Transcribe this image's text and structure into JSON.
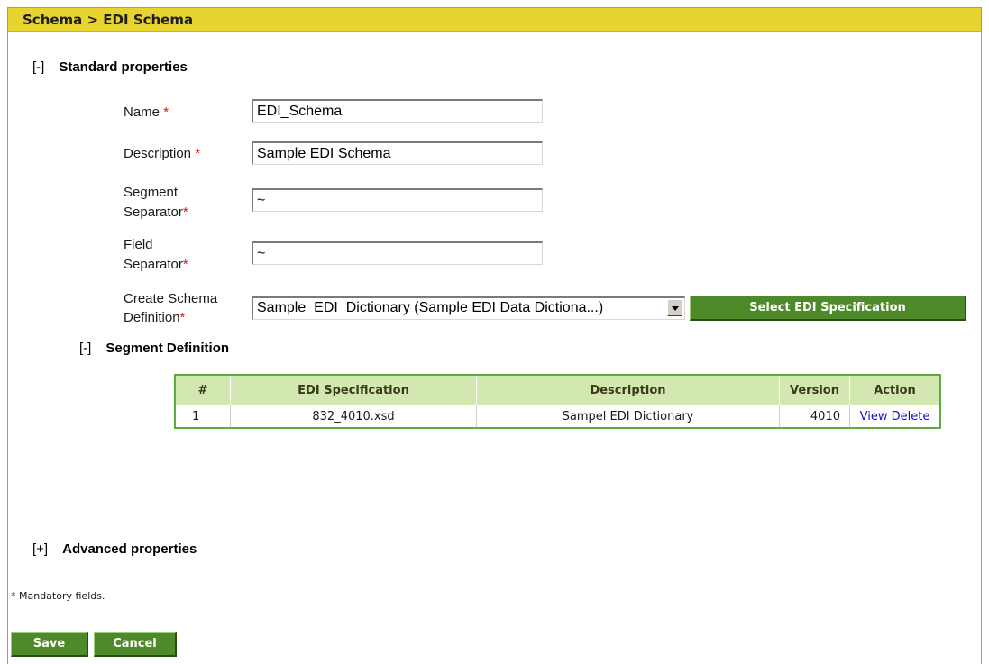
{
  "breadcrumb": "Schema > EDI Schema",
  "standard_properties": {
    "toggle": "[-]",
    "title": "Standard properties"
  },
  "fields": {
    "name": {
      "label": "Name",
      "value": "EDI_Schema"
    },
    "description": {
      "label": "Description",
      "value": "Sample EDI Schema"
    },
    "segment_separator": {
      "label_line1": "Segment",
      "label_line2": "Separator",
      "value": "~"
    },
    "field_separator": {
      "label_line1": "Field",
      "label_line2": "Separator",
      "value": "~"
    },
    "create_schema": {
      "label_line1": "Create Schema",
      "label_line2": "Definition",
      "selected": "Sample_EDI_Dictionary (Sample EDI Data Dictiona...)"
    }
  },
  "required_mark": "*",
  "select_spec_button": "Select EDI Specification",
  "segment_definition": {
    "toggle": "[-]",
    "title": "Segment Definition"
  },
  "table": {
    "headers": [
      "#",
      "EDI Specification",
      "Description",
      "Version",
      "Action"
    ],
    "rows": [
      {
        "num": "1",
        "spec": "832_4010.xsd",
        "description": "Sampel EDI Dictionary",
        "version": "4010",
        "view": "View",
        "delete": "Delete"
      }
    ]
  },
  "advanced_properties": {
    "toggle": "[+]",
    "title": "Advanced properties"
  },
  "mandatory_note": "Mandatory fields.",
  "buttons": {
    "save": "Save",
    "cancel": "Cancel"
  },
  "colors": {
    "title_bar": "#e8d42f",
    "button_green": "#4f8a2a",
    "table_border": "#5cac3a",
    "table_header": "#d3e7b0",
    "required": "#e01010",
    "link": "#1010c0"
  }
}
